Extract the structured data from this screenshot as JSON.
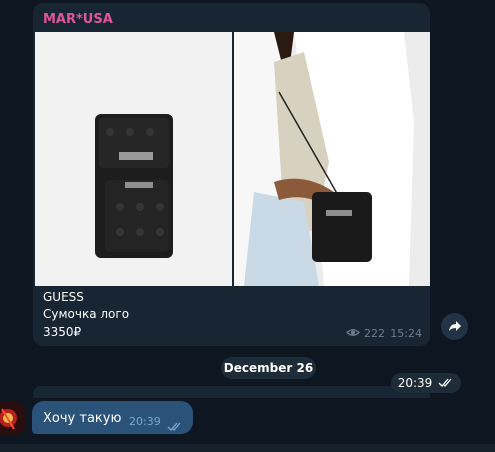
{
  "post": {
    "channel_name": "MAR*USA",
    "caption_line1": "GUESS",
    "caption_line2": "Сумочка лого",
    "caption_line3": "3350₽",
    "views": "222",
    "time": "15:24"
  },
  "date_separator": "December 26",
  "sticker": {
    "time": "20:39"
  },
  "message": {
    "text": "Хочу такую",
    "time": "20:39"
  },
  "colors": {
    "channel_name": "#e1559a",
    "outgoing_bubble": "#2b5278",
    "incoming_bubble": "#182533",
    "background": "#0e1621"
  },
  "icons": [
    "eye-icon",
    "forward-arrow-icon",
    "double-check-icon"
  ]
}
